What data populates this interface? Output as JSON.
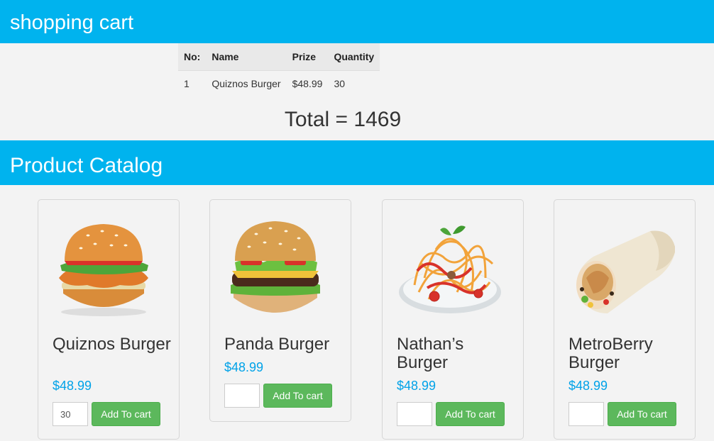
{
  "cart_header": {
    "title": "shopping cart"
  },
  "cart_table": {
    "columns": [
      "No:",
      "Name",
      "Prize",
      "Quantity"
    ],
    "rows": [
      {
        "no": "1",
        "name": "Quiznos Burger",
        "prize": "$48.99",
        "quantity": "30"
      }
    ]
  },
  "total_text": "Total = 1469",
  "catalog_header": {
    "title": "Product Catalog"
  },
  "products": [
    {
      "name": "Quiznos Burger",
      "price": "$48.99",
      "qty": "30",
      "button": "Add To cart",
      "image_icon": "burger-icon"
    },
    {
      "name": "Panda Burger",
      "price": "$48.99",
      "qty": "",
      "button": "Add To cart",
      "image_icon": "burger-icon"
    },
    {
      "name": "Nathan’s Burger",
      "price": "$48.99",
      "qty": "",
      "button": "Add To cart",
      "image_icon": "spaghetti-icon"
    },
    {
      "name": "MetroBerry Burger",
      "price": "$48.99",
      "qty": "",
      "button": "Add To cart",
      "image_icon": "wrap-icon"
    }
  ],
  "colors": {
    "banner": "#00b3ee",
    "price": "#00a2e8",
    "button": "#5cb85c",
    "background": "#f3f3f3"
  }
}
